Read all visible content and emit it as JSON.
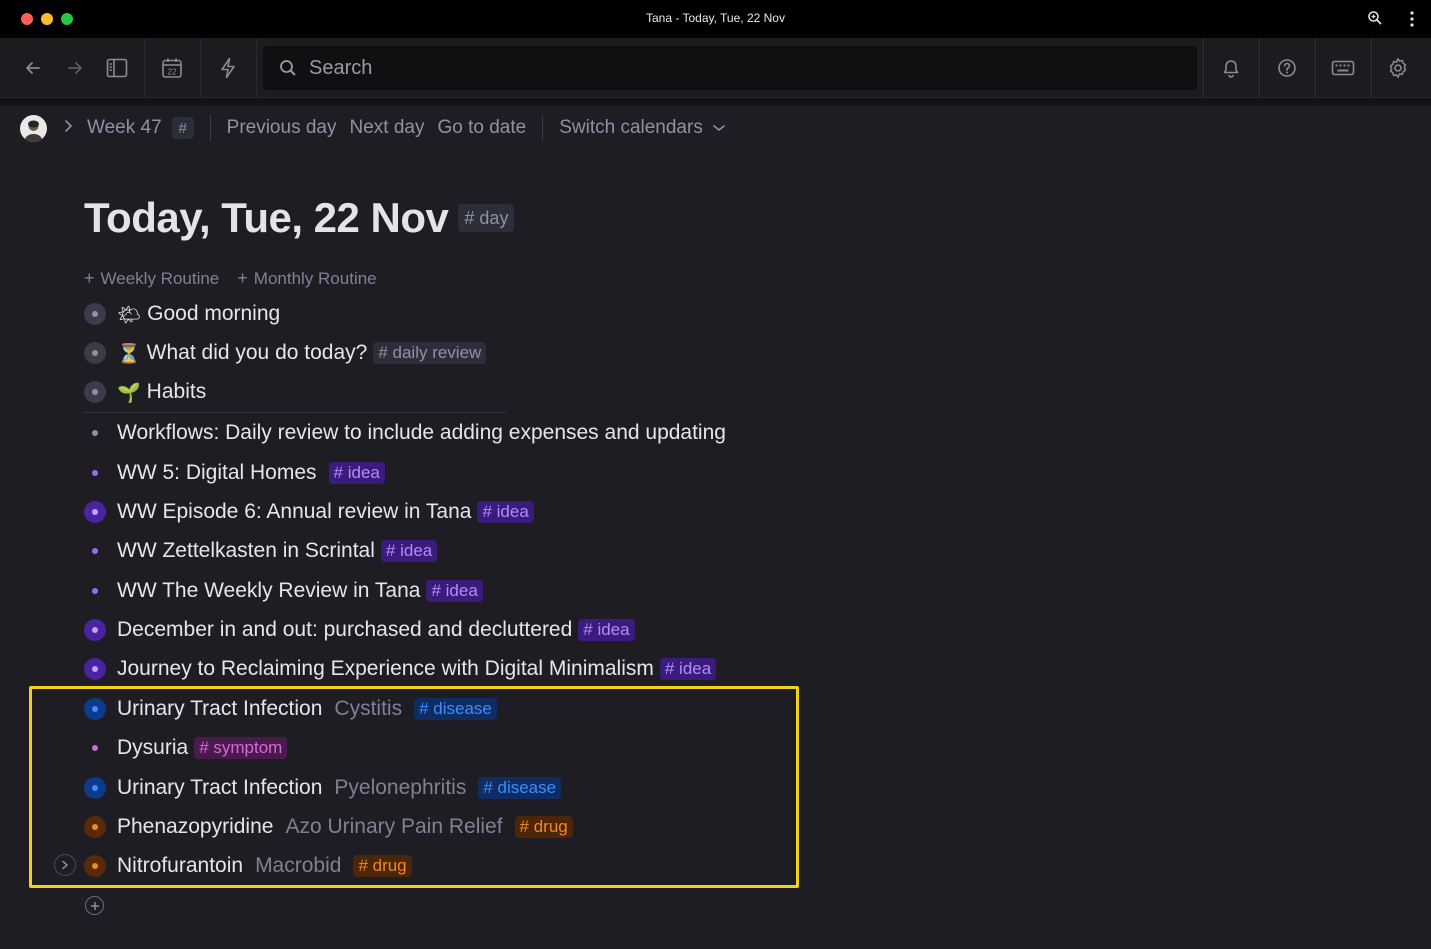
{
  "window": {
    "title": "Tana - Today, Tue, 22 Nov"
  },
  "toolbar": {
    "search_placeholder": "Search",
    "calendar_day": "22"
  },
  "breadcrumb": {
    "week": "Week 47",
    "hash": "#",
    "links": [
      "Previous day",
      "Next day",
      "Go to date"
    ],
    "switch_calendars": "Switch calendars"
  },
  "page": {
    "title": "Today, Tue, 22 Nov",
    "tag": "# day",
    "routines": [
      "Weekly Routine",
      "Monthly Routine"
    ]
  },
  "nodes": [
    {
      "emoji": "🌤",
      "text": "Good morning",
      "secondary": "",
      "tag": "",
      "bullet": "gray-ring"
    },
    {
      "emoji": "⏳",
      "text": "What did you do today?",
      "secondary": "",
      "tag": "# daily review",
      "bullet": "gray-ring"
    },
    {
      "emoji": "🌱",
      "text": "Habits",
      "secondary": "",
      "tag": "",
      "bullet": "gray-ring"
    },
    {
      "emoji": "",
      "text": "Workflows: Daily review to include adding expenses and updating",
      "secondary": "",
      "tag": "",
      "bullet": "gray-dot"
    },
    {
      "emoji": "",
      "text": "WW 5: Digital Homes",
      "secondary": "",
      "tag": "# idea",
      "bullet": "purple-dot"
    },
    {
      "emoji": "",
      "text": "WW Episode 6: Annual review in Tana",
      "secondary": "",
      "tag": "# idea",
      "bullet": "purple-ring"
    },
    {
      "emoji": "",
      "text": "WW Zettelkasten in Scrintal",
      "secondary": "",
      "tag": "# idea",
      "bullet": "purple-dot"
    },
    {
      "emoji": "",
      "text": "WW The Weekly Review in Tana",
      "secondary": "",
      "tag": "# idea",
      "bullet": "purple-dot"
    },
    {
      "emoji": "",
      "text": "December in and out: purchased and decluttered",
      "secondary": "",
      "tag": "# idea",
      "bullet": "purple-ring"
    },
    {
      "emoji": "",
      "text": "Journey to Reclaiming Experience with Digital Minimalism",
      "secondary": "",
      "tag": "# idea",
      "bullet": "purple-ring"
    },
    {
      "emoji": "",
      "text": "Urinary Tract Infection",
      "secondary": "Cystitis",
      "tag": "# disease",
      "bullet": "blue-ring"
    },
    {
      "emoji": "",
      "text": "Dysuria",
      "secondary": "",
      "tag": "# symptom",
      "bullet": "magenta-dot"
    },
    {
      "emoji": "",
      "text": "Urinary Tract Infection",
      "secondary": "Pyelonephritis",
      "tag": "# disease",
      "bullet": "blue-ring"
    },
    {
      "emoji": "",
      "text": "Phenazopyridine",
      "secondary": "Azo Urinary Pain Relief",
      "tag": "# drug",
      "bullet": "orange-ring"
    },
    {
      "emoji": "",
      "text": "Nitrofurantoin",
      "secondary": "Macrobid",
      "tag": "# drug",
      "bullet": "orange-ring"
    }
  ],
  "colors": {
    "highlight": "#f5d21a",
    "idea": "#b08cff",
    "disease": "#3d8cff",
    "symptom": "#d36ad6",
    "drug": "#f08a24"
  }
}
